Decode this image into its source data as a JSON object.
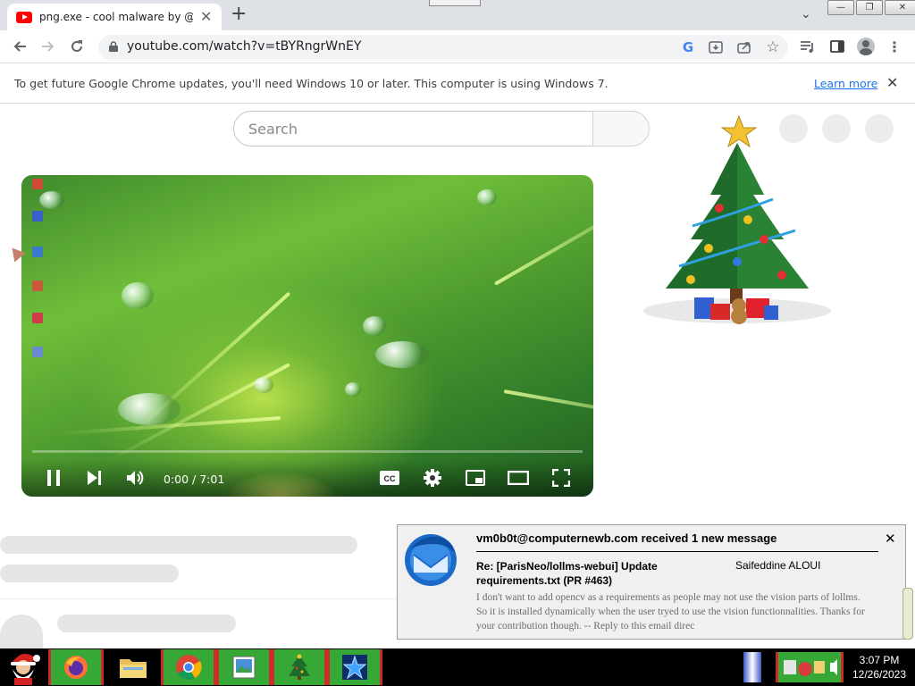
{
  "browser": {
    "tab_title": "png.exe - cool malware by @not",
    "url": "youtube.com/watch?v=tBYRngrWnEY",
    "window_buttons": [
      "minimize",
      "restore",
      "close"
    ]
  },
  "infobar": {
    "message": "To get future Google Chrome updates, you'll need Windows 10 or later. This computer is using Windows 7.",
    "link": "Learn more"
  },
  "youtube": {
    "search_placeholder": "Search",
    "player": {
      "time": "0:00 / 7:01",
      "progress": 0
    }
  },
  "notification": {
    "title": "vm0b0t@computernewb.com received 1 new message",
    "subject": "Re: [ParisNeo/lollms-webui] Update requirements.txt (PR #463)",
    "sender": "Saifeddine ALOUI",
    "body": "I don't want to add opencv as a requirements as people may not use the vision parts of lollms. So it is installed dynamically when the user tryed to use the vision functionnalities. Thanks for your contribution though. -- Reply to this email direc"
  },
  "taskbar": {
    "time": "3:07 PM",
    "date": "12/26/2023",
    "items": [
      "firefox-icon",
      "file-explorer-icon",
      "chrome-icon",
      "picture-viewer-icon",
      "christmas-tree-icon",
      "star-app-icon"
    ]
  },
  "colors": {
    "youtube_red": "#ff0000",
    "link_blue": "#1a73e8",
    "taskbar_green": "#36a836",
    "taskbar_red": "#cf2a2a",
    "thunderbird_blue": "#1b6ac9"
  }
}
